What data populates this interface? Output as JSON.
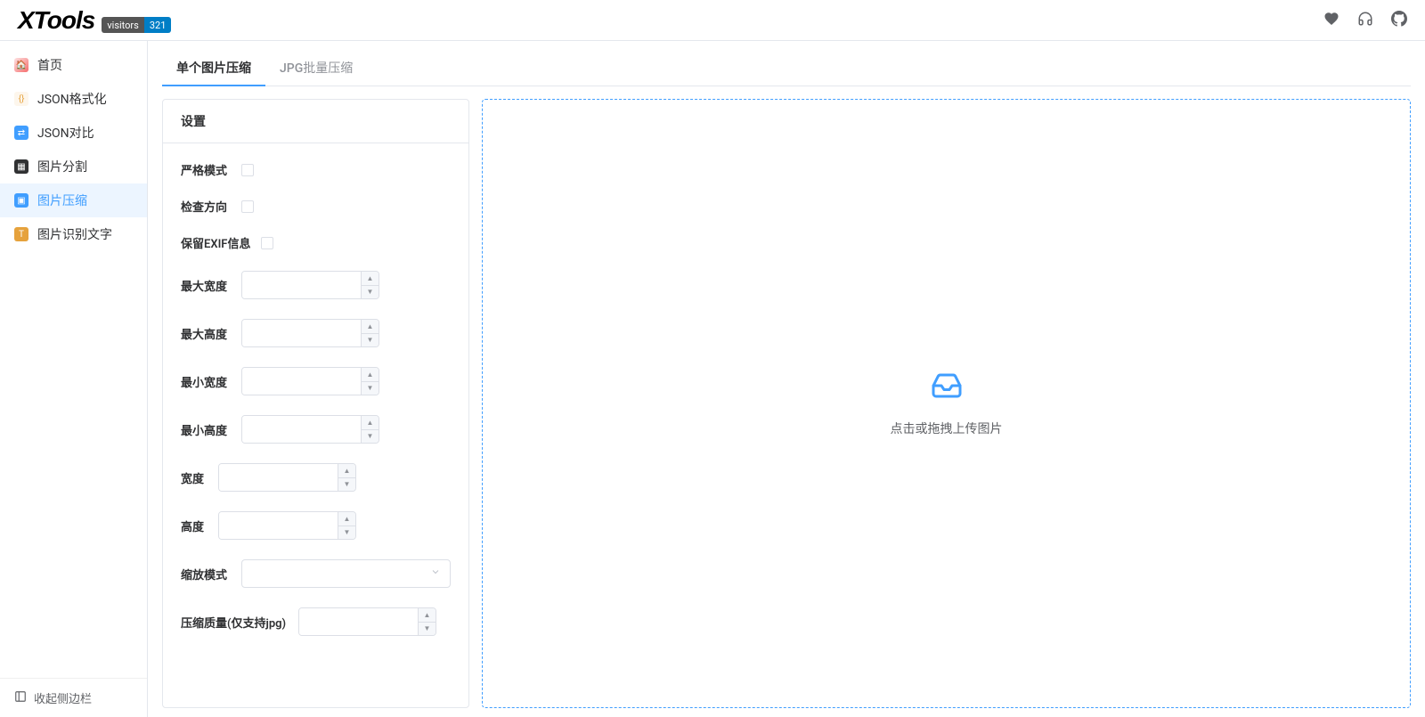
{
  "header": {
    "logo": "XTools",
    "badge_label": "visitors",
    "badge_value": "321"
  },
  "sidebar": {
    "items": [
      {
        "label": "首页",
        "icon_bg": "#f56c6c"
      },
      {
        "label": "JSON格式化",
        "icon_bg": "#e6a23c"
      },
      {
        "label": "JSON对比",
        "icon_bg": "#409eff"
      },
      {
        "label": "图片分割",
        "icon_bg": "#67c23a"
      },
      {
        "label": "图片压缩",
        "icon_bg": "#409eff"
      },
      {
        "label": "图片识别文字",
        "icon_bg": "#e6a23c"
      }
    ],
    "collapse_label": "收起侧边栏"
  },
  "tabs": [
    {
      "label": "单个图片压缩"
    },
    {
      "label": "JPG批量压缩"
    }
  ],
  "settings": {
    "title": "设置",
    "strict_mode": "严格模式",
    "check_orientation": "检查方向",
    "keep_exif": "保留EXIF信息",
    "max_width": "最大宽度",
    "max_height": "最大高度",
    "min_width": "最小宽度",
    "min_height": "最小高度",
    "width": "宽度",
    "height": "高度",
    "scale_mode": "缩放模式",
    "quality": "压缩质量(仅支持jpg)"
  },
  "dropzone": {
    "text": "点击或拖拽上传图片"
  }
}
